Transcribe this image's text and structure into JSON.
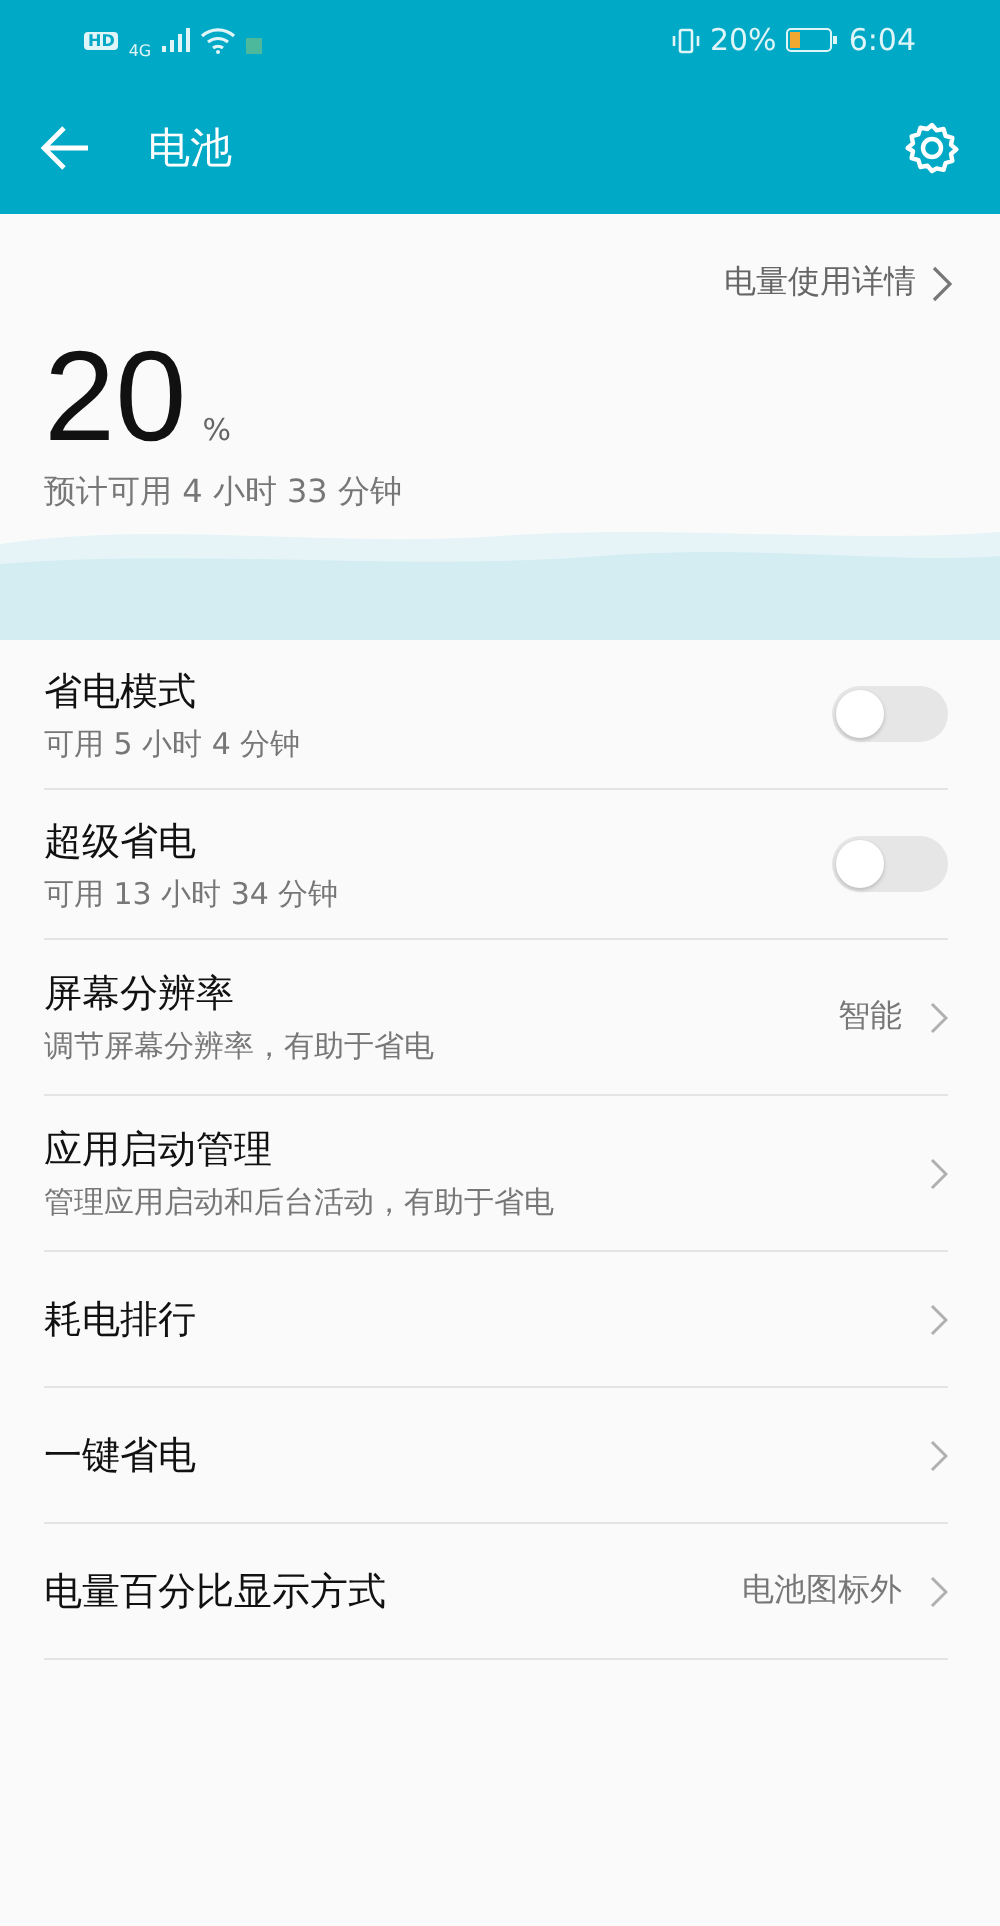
{
  "status_bar": {
    "hd": "HD",
    "network": "4G",
    "battery_text": "20%",
    "time": "6:04"
  },
  "app_bar": {
    "title": "电池"
  },
  "summary": {
    "details_link": "电量使用详情",
    "percent": "20",
    "percent_sign": "%",
    "estimate": "预计可用 4 小时 33 分钟"
  },
  "settings": [
    {
      "kind": "toggle",
      "title": "省电模式",
      "subtitle": "可用 5 小时 4 分钟",
      "on": false
    },
    {
      "kind": "toggle",
      "title": "超级省电",
      "subtitle": "可用 13 小时 34 分钟",
      "on": false
    },
    {
      "kind": "link",
      "title": "屏幕分辨率",
      "subtitle": "调节屏幕分辨率，有助于省电",
      "value": "智能"
    },
    {
      "kind": "link",
      "title": "应用启动管理",
      "subtitle": "管理应用启动和后台活动，有助于省电"
    },
    {
      "kind": "link",
      "title": "耗电排行"
    },
    {
      "kind": "link",
      "title": "一键省电"
    },
    {
      "kind": "link",
      "title": "电量百分比显示方式",
      "value": "电池图标外"
    }
  ]
}
